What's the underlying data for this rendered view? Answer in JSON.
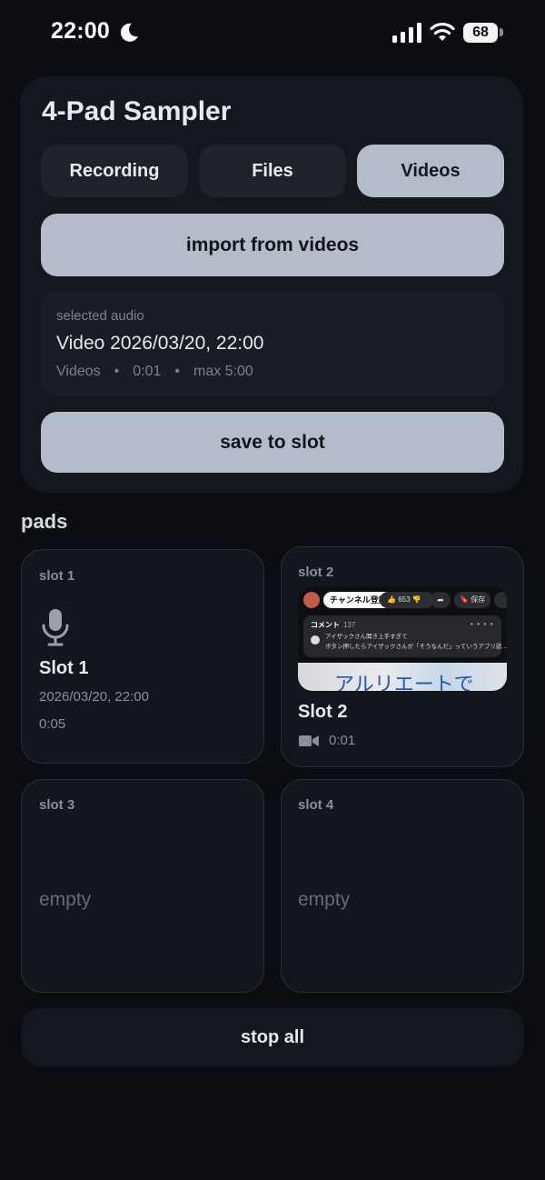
{
  "status_bar": {
    "time": "22:00",
    "battery": "68",
    "icons": [
      "moon-icon",
      "signal-icon",
      "wifi-icon",
      "battery-icon"
    ]
  },
  "app": {
    "title": "4-Pad Sampler"
  },
  "tabs": [
    {
      "label": "Recording",
      "active": false
    },
    {
      "label": "Files",
      "active": false
    },
    {
      "label": "Videos",
      "active": true
    }
  ],
  "import_button": "import from videos",
  "selected_audio": {
    "label": "selected audio",
    "title": "Video 2026/03/20, 22:00",
    "source": "Videos",
    "duration": "0:01",
    "max": "max 5:00",
    "separator": "•"
  },
  "save_button": "save to slot",
  "pads_heading": "pads",
  "pads": [
    {
      "slot_label": "slot 1",
      "name": "Slot 1",
      "date": "2026/03/20, 22:00",
      "duration": "0:05",
      "icon": "microphone-icon"
    },
    {
      "slot_label": "slot 2",
      "name": "Slot 2",
      "duration": "0:01",
      "icon": "video-camera-icon",
      "thumbnail": {
        "subscribe": "チャンネル登録",
        "likes": "653",
        "save": "保存",
        "comments_title": "コメント",
        "comments_count": "137",
        "comment_line_1": "アイザックさん聞き上手すぎて",
        "comment_line_2": "ボタン押したらアイザックさんが「そうなんだ」っていうアプリ欲…",
        "bottom_text": "アルリエートで"
      }
    },
    {
      "slot_label": "slot 3",
      "empty_text": "empty"
    },
    {
      "slot_label": "slot 4",
      "empty_text": "empty"
    }
  ],
  "stop_all_button": "stop all",
  "colors": {
    "background": "#0b0d12",
    "panel": "#14171d",
    "accent_button": "#b3bcc8",
    "muted_text": "#7d838d"
  }
}
